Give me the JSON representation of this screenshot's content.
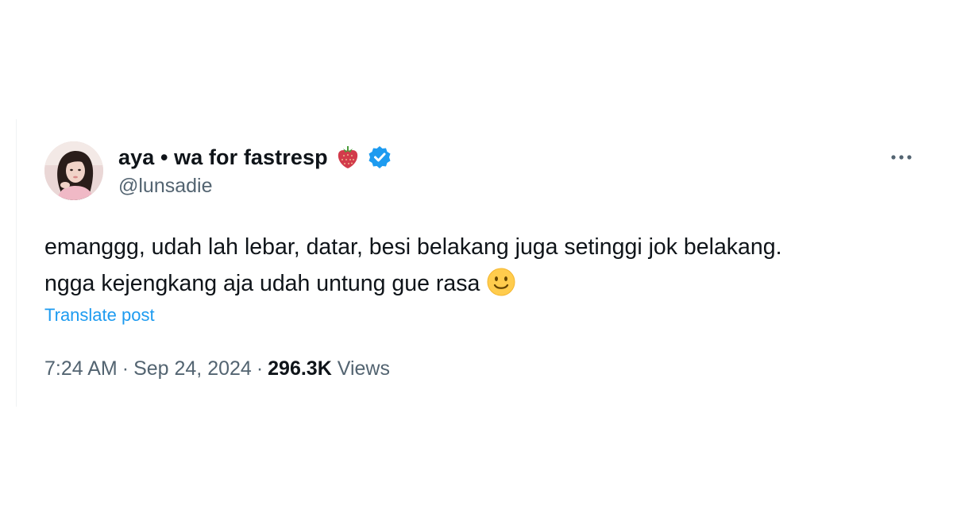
{
  "post": {
    "author": {
      "display_name": "aya • wa for fastresp",
      "handle": "@lunsadie",
      "name_emoji": "strawberry-icon",
      "verified": true,
      "verified_color": "#1d9bf0"
    },
    "more_icon": "more-horizontal-icon",
    "text_lines": [
      "emanggg, udah lah lebar, datar, besi belakang juga setinggi jok belakang.",
      "ngga kejengkang aja udah untung gue rasa"
    ],
    "text_end_emoji": "slightly-smiling-face-icon",
    "translate_label": "Translate post",
    "time": "7:24 AM",
    "separator": "·",
    "date": "Sep 24, 2024",
    "views_count": "296.3K",
    "views_label": "Views"
  },
  "colors": {
    "text_primary": "#0f1419",
    "text_secondary": "#536471",
    "link": "#1d9bf0"
  }
}
